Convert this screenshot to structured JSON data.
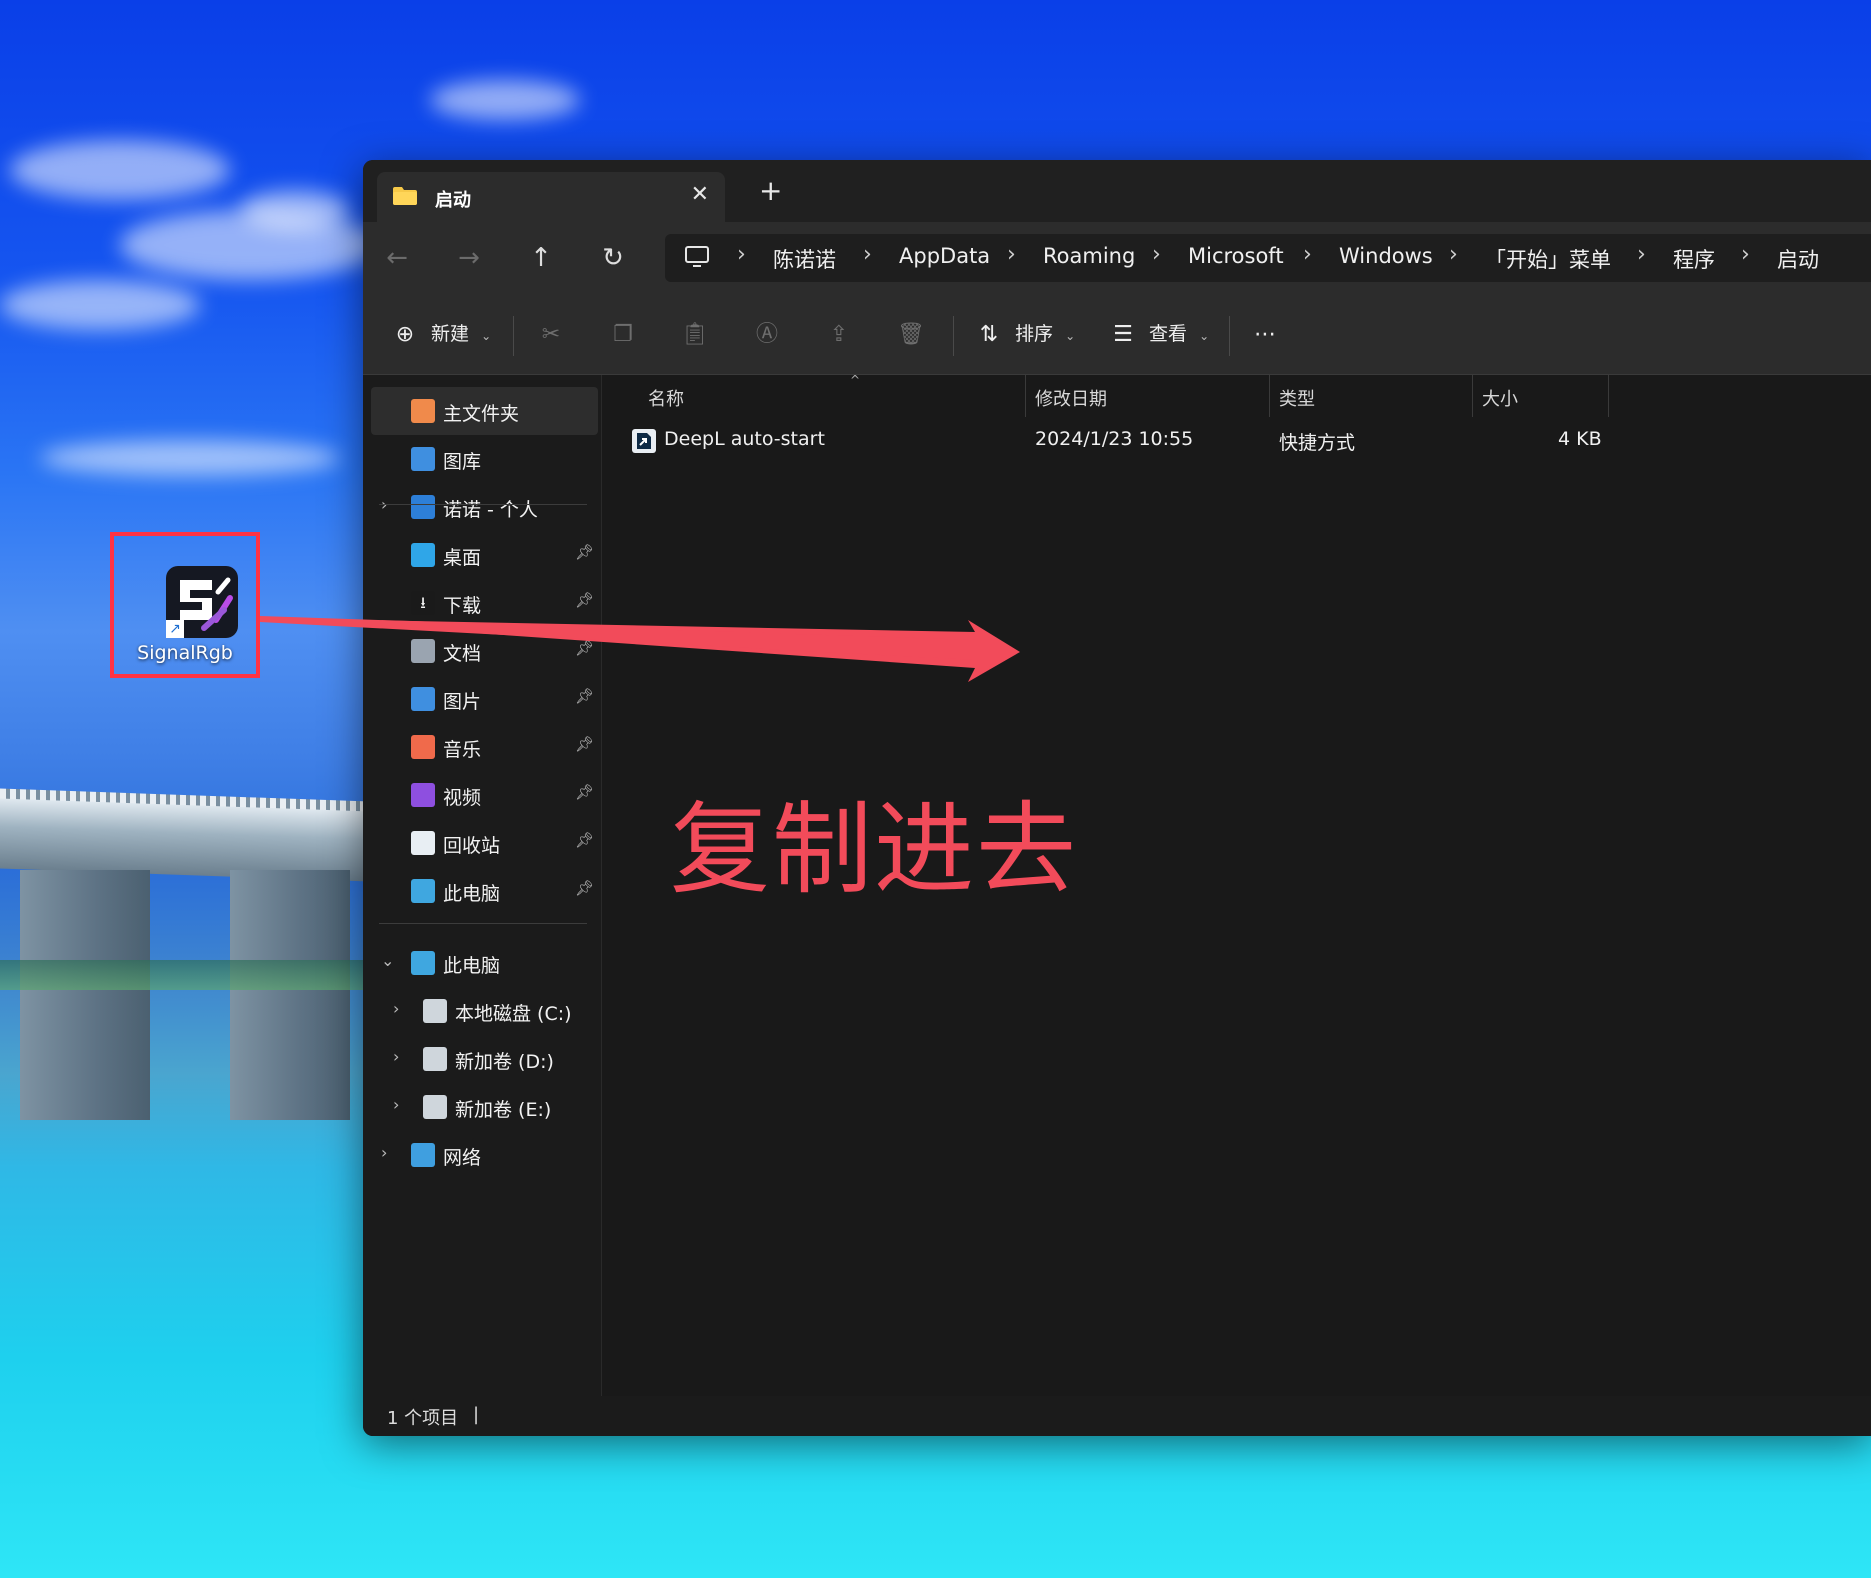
{
  "desktop": {
    "shortcut_label": "SignalRgb",
    "annotation_text": "复制进去"
  },
  "window": {
    "tab_title": "启动",
    "breadcrumb": [
      "陈诺诺",
      "AppData",
      "Roaming",
      "Microsoft",
      "Windows",
      "「开始」菜单",
      "程序",
      "启动"
    ]
  },
  "toolbar": {
    "new_label": "新建",
    "sort_label": "排序",
    "view_label": "查看"
  },
  "sidebar": {
    "home": "主文件夹",
    "gallery": "图库",
    "onedrive": "诺诺 - 个人",
    "quick": [
      "桌面",
      "下载",
      "文档",
      "图片",
      "音乐",
      "视频",
      "回收站",
      "此电脑"
    ],
    "thispc": "此电脑",
    "drives": [
      "本地磁盘 (C:)",
      "新加卷 (D:)",
      "新加卷 (E:)"
    ],
    "network": "网络"
  },
  "columns": {
    "name": "名称",
    "date": "修改日期",
    "type": "类型",
    "size": "大小"
  },
  "files": [
    {
      "name": "DeepL auto-start",
      "date": "2024/1/23 10:55",
      "type": "快捷方式",
      "size": "4 KB"
    }
  ],
  "status": {
    "count": "1 个项目"
  },
  "colors": {
    "accent_annotation": "#f24b5a",
    "highlight_box": "#ff3344"
  }
}
